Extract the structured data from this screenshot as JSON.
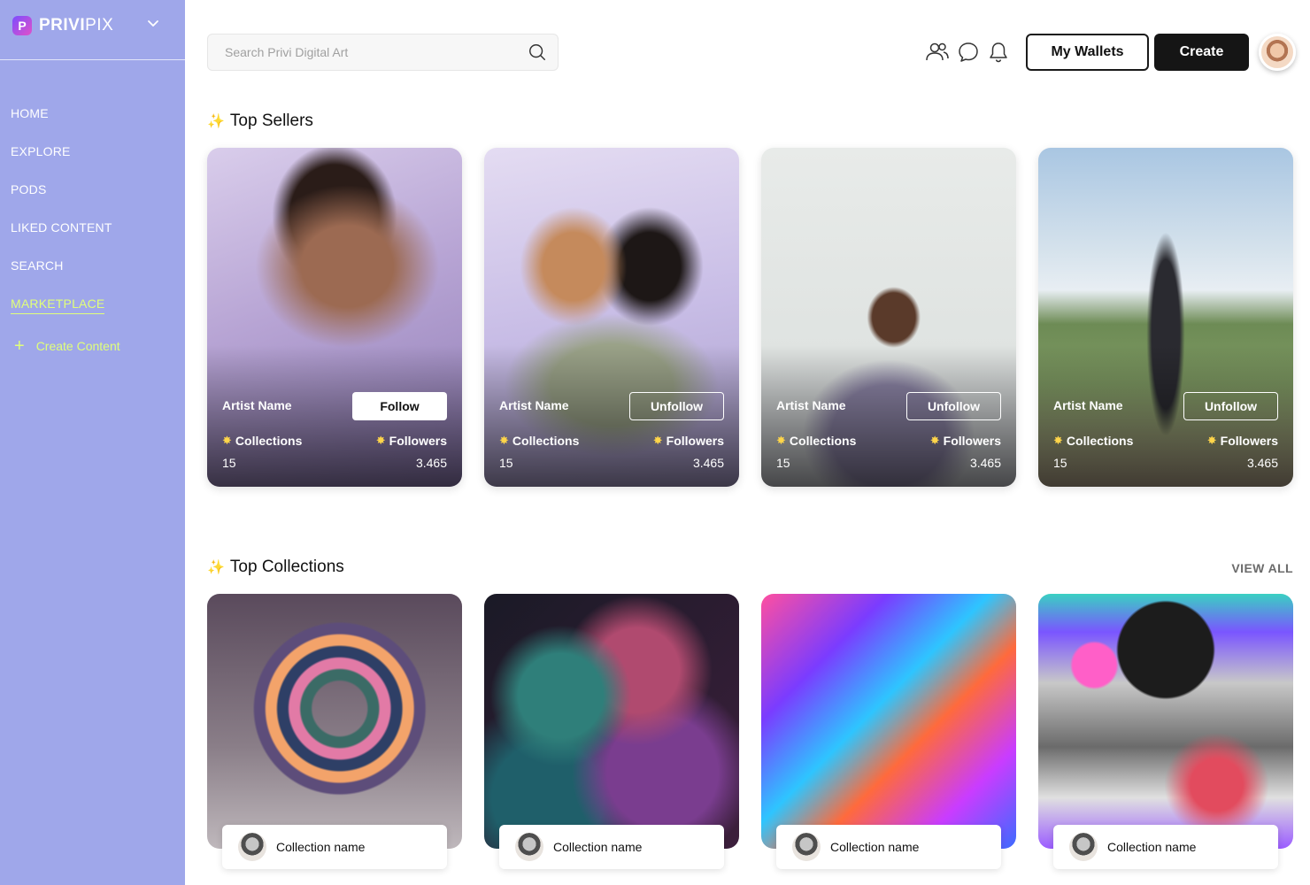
{
  "brand": {
    "name_bold": "PRIVI",
    "name_light": "PIX",
    "logo_letter": "P"
  },
  "nav": {
    "items": [
      {
        "label": "HOME"
      },
      {
        "label": "EXPLORE"
      },
      {
        "label": "PODS"
      },
      {
        "label": "LIKED CONTENT"
      },
      {
        "label": "SEARCH"
      },
      {
        "label": "MARKETPLACE",
        "active": true
      }
    ],
    "create_content": "Create Content"
  },
  "header": {
    "search_placeholder": "Search Privi Digital Art",
    "wallets_label": "My Wallets",
    "create_label": "Create",
    "icons": [
      "people-icon",
      "chat-icon",
      "bell-icon",
      "search-icon"
    ]
  },
  "top_sellers": {
    "title": "Top Sellers",
    "sellers": [
      {
        "artist": "Artist Name",
        "action": "Follow",
        "collections_label": "Collections",
        "collections": "15",
        "followers_label": "Followers",
        "followers": "3.465"
      },
      {
        "artist": "Artist Name",
        "action": "Unfollow",
        "collections_label": "Collections",
        "collections": "15",
        "followers_label": "Followers",
        "followers": "3.465"
      },
      {
        "artist": "Artist Name",
        "action": "Unfollow",
        "collections_label": "Collections",
        "collections": "15",
        "followers_label": "Followers",
        "followers": "3.465"
      },
      {
        "artist": "Artist Name",
        "action": "Unfollow",
        "collections_label": "Collections",
        "collections": "15",
        "followers_label": "Followers",
        "followers": "3.465"
      }
    ]
  },
  "top_collections": {
    "title": "Top Collections",
    "view_all": "VIEW ALL",
    "collections": [
      {
        "name": "Collection name"
      },
      {
        "name": "Collection name"
      },
      {
        "name": "Collection name"
      },
      {
        "name": "Collection name"
      }
    ]
  },
  "colors": {
    "sidebar_bg": "#9fa7ea",
    "accent_lime": "#e0ff7a",
    "button_dark": "#151515"
  }
}
